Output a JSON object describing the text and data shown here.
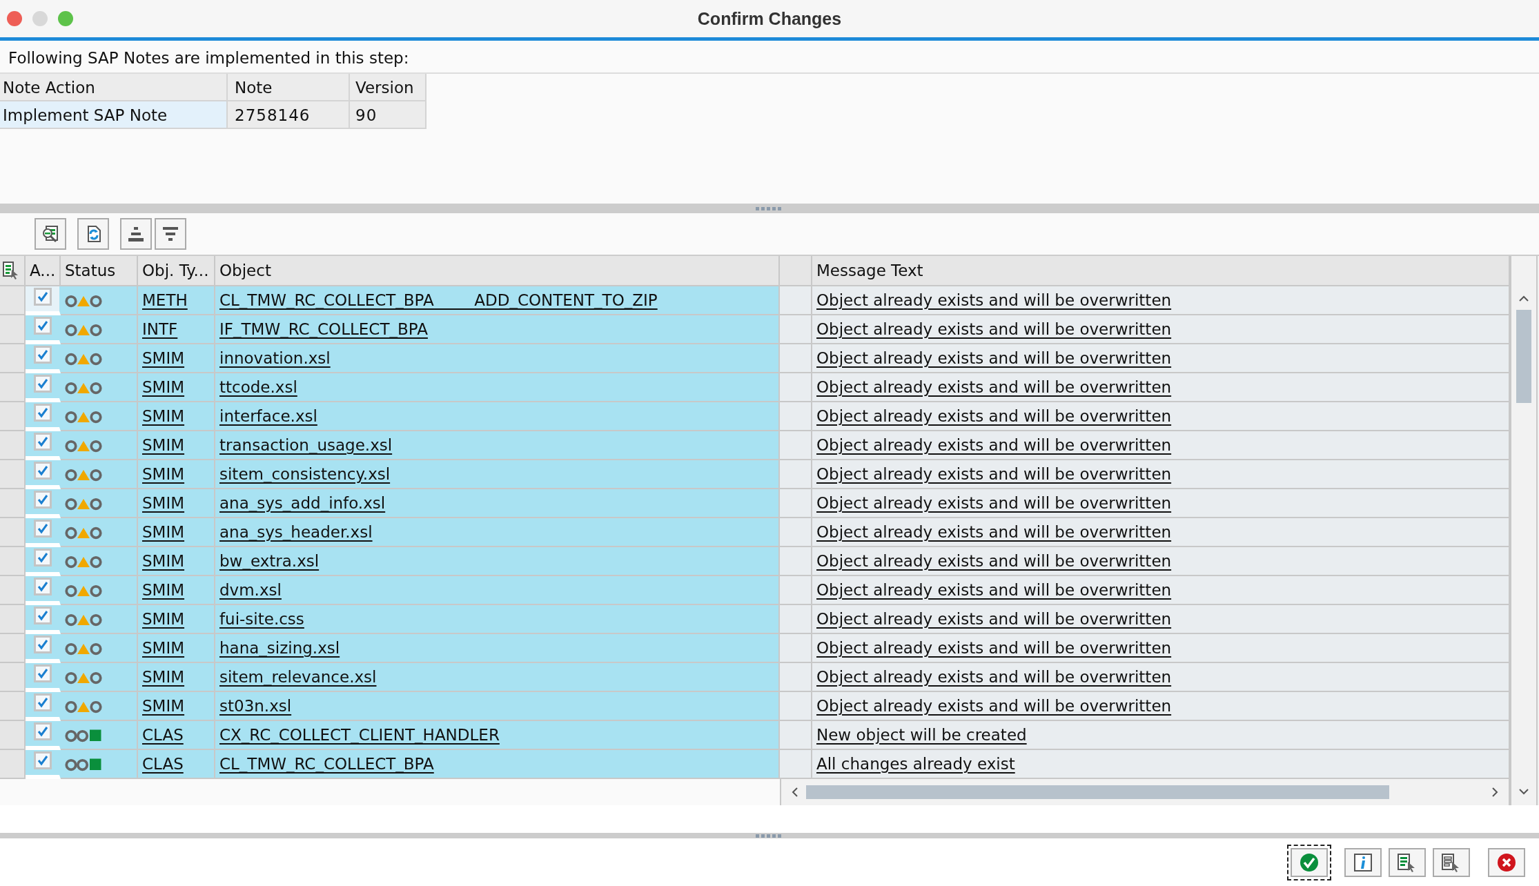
{
  "window": {
    "title": "Confirm Changes"
  },
  "notes_intro": "Following SAP Notes are implemented in this step:",
  "notes_table": {
    "columns": [
      "Note Action",
      "Note",
      "Version"
    ],
    "rows": [
      [
        "Implement SAP Note",
        "2758146",
        "90"
      ]
    ]
  },
  "objects_table": {
    "columns": [
      "A...",
      "Status",
      "Obj. Ty...",
      "Object",
      "",
      "Message Text"
    ],
    "rows": [
      {
        "checked": true,
        "kind": "warning",
        "type": "METH",
        "object": "CL_TMW_RC_COLLECT_BPA        ADD_CONTENT_TO_ZIP",
        "message": "Object already exists and will be overwritten"
      },
      {
        "checked": true,
        "kind": "warning",
        "type": "INTF",
        "object": "IF_TMW_RC_COLLECT_BPA",
        "message": "Object already exists and will be overwritten"
      },
      {
        "checked": true,
        "kind": "warning",
        "type": "SMIM",
        "object": "innovation.xsl",
        "message": "Object already exists and will be overwritten"
      },
      {
        "checked": true,
        "kind": "warning",
        "type": "SMIM",
        "object": "ttcode.xsl",
        "message": "Object already exists and will be overwritten"
      },
      {
        "checked": true,
        "kind": "warning",
        "type": "SMIM",
        "object": "interface.xsl",
        "message": "Object already exists and will be overwritten"
      },
      {
        "checked": true,
        "kind": "warning",
        "type": "SMIM",
        "object": "transaction_usage.xsl",
        "message": "Object already exists and will be overwritten"
      },
      {
        "checked": true,
        "kind": "warning",
        "type": "SMIM",
        "object": "sitem_consistency.xsl",
        "message": "Object already exists and will be overwritten"
      },
      {
        "checked": true,
        "kind": "warning",
        "type": "SMIM",
        "object": "ana_sys_add_info.xsl",
        "message": "Object already exists and will be overwritten"
      },
      {
        "checked": true,
        "kind": "warning",
        "type": "SMIM",
        "object": "ana_sys_header.xsl",
        "message": "Object already exists and will be overwritten"
      },
      {
        "checked": true,
        "kind": "warning",
        "type": "SMIM",
        "object": "bw_extra.xsl",
        "message": "Object already exists and will be overwritten"
      },
      {
        "checked": true,
        "kind": "warning",
        "type": "SMIM",
        "object": "dvm.xsl",
        "message": "Object already exists and will be overwritten"
      },
      {
        "checked": true,
        "kind": "warning",
        "type": "SMIM",
        "object": "fui-site.css",
        "message": "Object already exists and will be overwritten"
      },
      {
        "checked": true,
        "kind": "warning",
        "type": "SMIM",
        "object": "hana_sizing.xsl",
        "message": "Object already exists and will be overwritten"
      },
      {
        "checked": true,
        "kind": "warning",
        "type": "SMIM",
        "object": "sitem_relevance.xsl",
        "message": "Object already exists and will be overwritten"
      },
      {
        "checked": true,
        "kind": "warning",
        "type": "SMIM",
        "object": "st03n.xsl",
        "message": "Object already exists and will be overwritten"
      },
      {
        "checked": true,
        "kind": "ok",
        "type": "CLAS",
        "object": "CX_RC_COLLECT_CLIENT_HANDLER",
        "message": "New object will be created"
      },
      {
        "checked": true,
        "kind": "ok",
        "type": "CLAS",
        "object": "CL_TMW_RC_COLLECT_BPA",
        "message": "All changes already exist"
      }
    ]
  }
}
